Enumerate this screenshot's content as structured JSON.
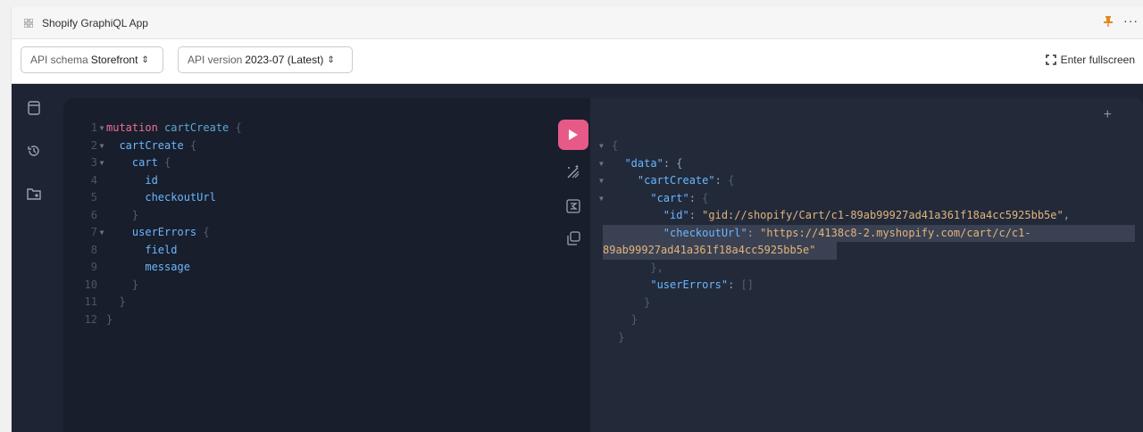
{
  "window": {
    "title": "Shopify GraphiQL App",
    "more_label": "···"
  },
  "toolbar": {
    "schema_label": "API schema",
    "schema_value": "Storefront",
    "version_label": "API version",
    "version_value": "2023-07 (Latest)",
    "caret": "⇕",
    "fullscreen_label": "Enter fullscreen"
  },
  "editor": {
    "lines": [
      {
        "n": "1",
        "fold": "▼"
      },
      {
        "n": "2",
        "fold": "▼"
      },
      {
        "n": "3",
        "fold": "▼"
      },
      {
        "n": "4",
        "fold": ""
      },
      {
        "n": "5",
        "fold": ""
      },
      {
        "n": "6",
        "fold": ""
      },
      {
        "n": "7",
        "fold": "▼"
      },
      {
        "n": "8",
        "fold": ""
      },
      {
        "n": "9",
        "fold": ""
      },
      {
        "n": "10",
        "fold": ""
      },
      {
        "n": "11",
        "fold": ""
      },
      {
        "n": "12",
        "fold": ""
      }
    ],
    "mutation_kw": "mutation",
    "operation_name": "cartCreate",
    "open_brace": "{",
    "close_brace": "}",
    "field_cartCreate": "cartCreate",
    "field_cart": "cart",
    "field_id": "id",
    "field_checkoutUrl": "checkoutUrl",
    "field_userErrors": "userErrors",
    "field_field": "field",
    "field_message": "message"
  },
  "response": {
    "plus": "+",
    "fold": "▼",
    "key_data": "\"data\"",
    "key_cartCreate": "\"cartCreate\"",
    "key_cart": "\"cart\"",
    "key_id": "\"id\"",
    "val_id": "\"gid://shopify/Cart/c1-89ab99927ad41a361f18a4cc5925bb5e\"",
    "key_checkoutUrl": "\"checkoutUrl\"",
    "val_checkoutUrl_part1": "\"https://4138c8-2.myshopify.com/cart/c/c1-",
    "val_checkoutUrl_part2": "89ab99927ad41a361f18a4cc5925bb5e\"",
    "key_userErrors": "\"userErrors\"",
    "val_userErrors": "[]",
    "colon": ": ",
    "open_brace": "{",
    "close_brace": "}",
    "comma": ",",
    "close_comma": "},"
  },
  "colors": {
    "run_button": "#e75a87",
    "editor_bg": "#181e2c",
    "response_bg": "#222a3a"
  }
}
